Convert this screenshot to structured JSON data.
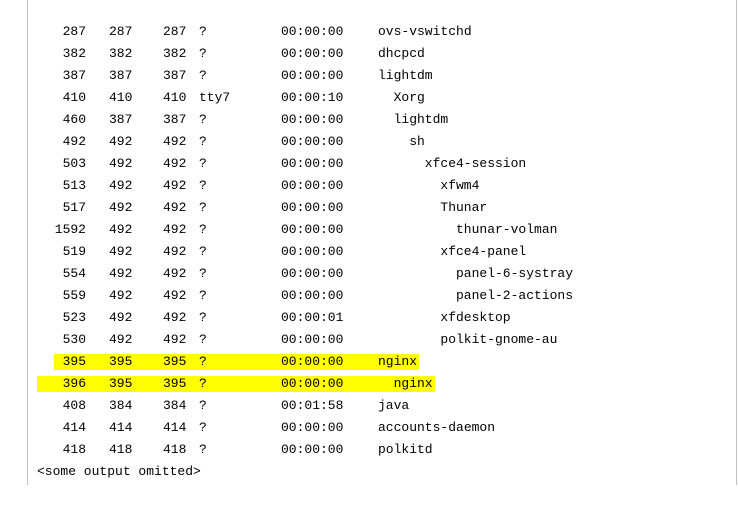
{
  "processes": [
    {
      "pid": "287",
      "ppid": "287",
      "pgid": "287",
      "tty": "?",
      "time": "00:00:00",
      "depth": 0,
      "cmd": "ovs-vswitchd",
      "highlight": false
    },
    {
      "pid": "382",
      "ppid": "382",
      "pgid": "382",
      "tty": "?",
      "time": "00:00:00",
      "depth": 0,
      "cmd": "dhcpcd",
      "highlight": false
    },
    {
      "pid": "387",
      "ppid": "387",
      "pgid": "387",
      "tty": "?",
      "time": "00:00:00",
      "depth": 0,
      "cmd": "lightdm",
      "highlight": false
    },
    {
      "pid": "410",
      "ppid": "410",
      "pgid": "410",
      "tty": "tty7",
      "time": "00:00:10",
      "depth": 1,
      "cmd": "Xorg",
      "highlight": false
    },
    {
      "pid": "460",
      "ppid": "387",
      "pgid": "387",
      "tty": "?",
      "time": "00:00:00",
      "depth": 1,
      "cmd": "lightdm",
      "highlight": false
    },
    {
      "pid": "492",
      "ppid": "492",
      "pgid": "492",
      "tty": "?",
      "time": "00:00:00",
      "depth": 2,
      "cmd": "sh",
      "highlight": false
    },
    {
      "pid": "503",
      "ppid": "492",
      "pgid": "492",
      "tty": "?",
      "time": "00:00:00",
      "depth": 3,
      "cmd": "xfce4-session",
      "highlight": false
    },
    {
      "pid": "513",
      "ppid": "492",
      "pgid": "492",
      "tty": "?",
      "time": "00:00:00",
      "depth": 4,
      "cmd": "xfwm4",
      "highlight": false
    },
    {
      "pid": "517",
      "ppid": "492",
      "pgid": "492",
      "tty": "?",
      "time": "00:00:00",
      "depth": 4,
      "cmd": "Thunar",
      "highlight": false
    },
    {
      "pid": "1592",
      "ppid": "492",
      "pgid": "492",
      "tty": "?",
      "time": "00:00:00",
      "depth": 5,
      "cmd": "thunar-volman",
      "highlight": false
    },
    {
      "pid": "519",
      "ppid": "492",
      "pgid": "492",
      "tty": "?",
      "time": "00:00:00",
      "depth": 4,
      "cmd": "xfce4-panel",
      "highlight": false
    },
    {
      "pid": "554",
      "ppid": "492",
      "pgid": "492",
      "tty": "?",
      "time": "00:00:00",
      "depth": 5,
      "cmd": "panel-6-systray",
      "highlight": false
    },
    {
      "pid": "559",
      "ppid": "492",
      "pgid": "492",
      "tty": "?",
      "time": "00:00:00",
      "depth": 5,
      "cmd": "panel-2-actions",
      "highlight": false
    },
    {
      "pid": "523",
      "ppid": "492",
      "pgid": "492",
      "tty": "?",
      "time": "00:00:01",
      "depth": 4,
      "cmd": "xfdesktop",
      "highlight": false
    },
    {
      "pid": "530",
      "ppid": "492",
      "pgid": "492",
      "tty": "?",
      "time": "00:00:00",
      "depth": 4,
      "cmd": "polkit-gnome-au",
      "highlight": false
    },
    {
      "pid": "395",
      "ppid": "395",
      "pgid": "395",
      "tty": "?",
      "time": "00:00:00",
      "depth": 0,
      "cmd": "nginx",
      "highlight": true
    },
    {
      "pid": "396",
      "ppid": "395",
      "pgid": "395",
      "tty": "?",
      "time": "00:00:00",
      "depth": 1,
      "cmd": "nginx",
      "highlight": true
    },
    {
      "pid": "408",
      "ppid": "384",
      "pgid": "384",
      "tty": "?",
      "time": "00:01:58",
      "depth": 0,
      "cmd": "java",
      "highlight": false
    },
    {
      "pid": "414",
      "ppid": "414",
      "pgid": "414",
      "tty": "?",
      "time": "00:00:00",
      "depth": 0,
      "cmd": "accounts-daemon",
      "highlight": false
    },
    {
      "pid": "418",
      "ppid": "418",
      "pgid": "418",
      "tty": "?",
      "time": "00:00:00",
      "depth": 0,
      "cmd": "polkitd",
      "highlight": false
    }
  ],
  "footer": "<some output omitted>",
  "colors": {
    "highlight": "#ffff00",
    "text": "#000000",
    "background": "#ffffff",
    "border": "#bfbfbf"
  }
}
